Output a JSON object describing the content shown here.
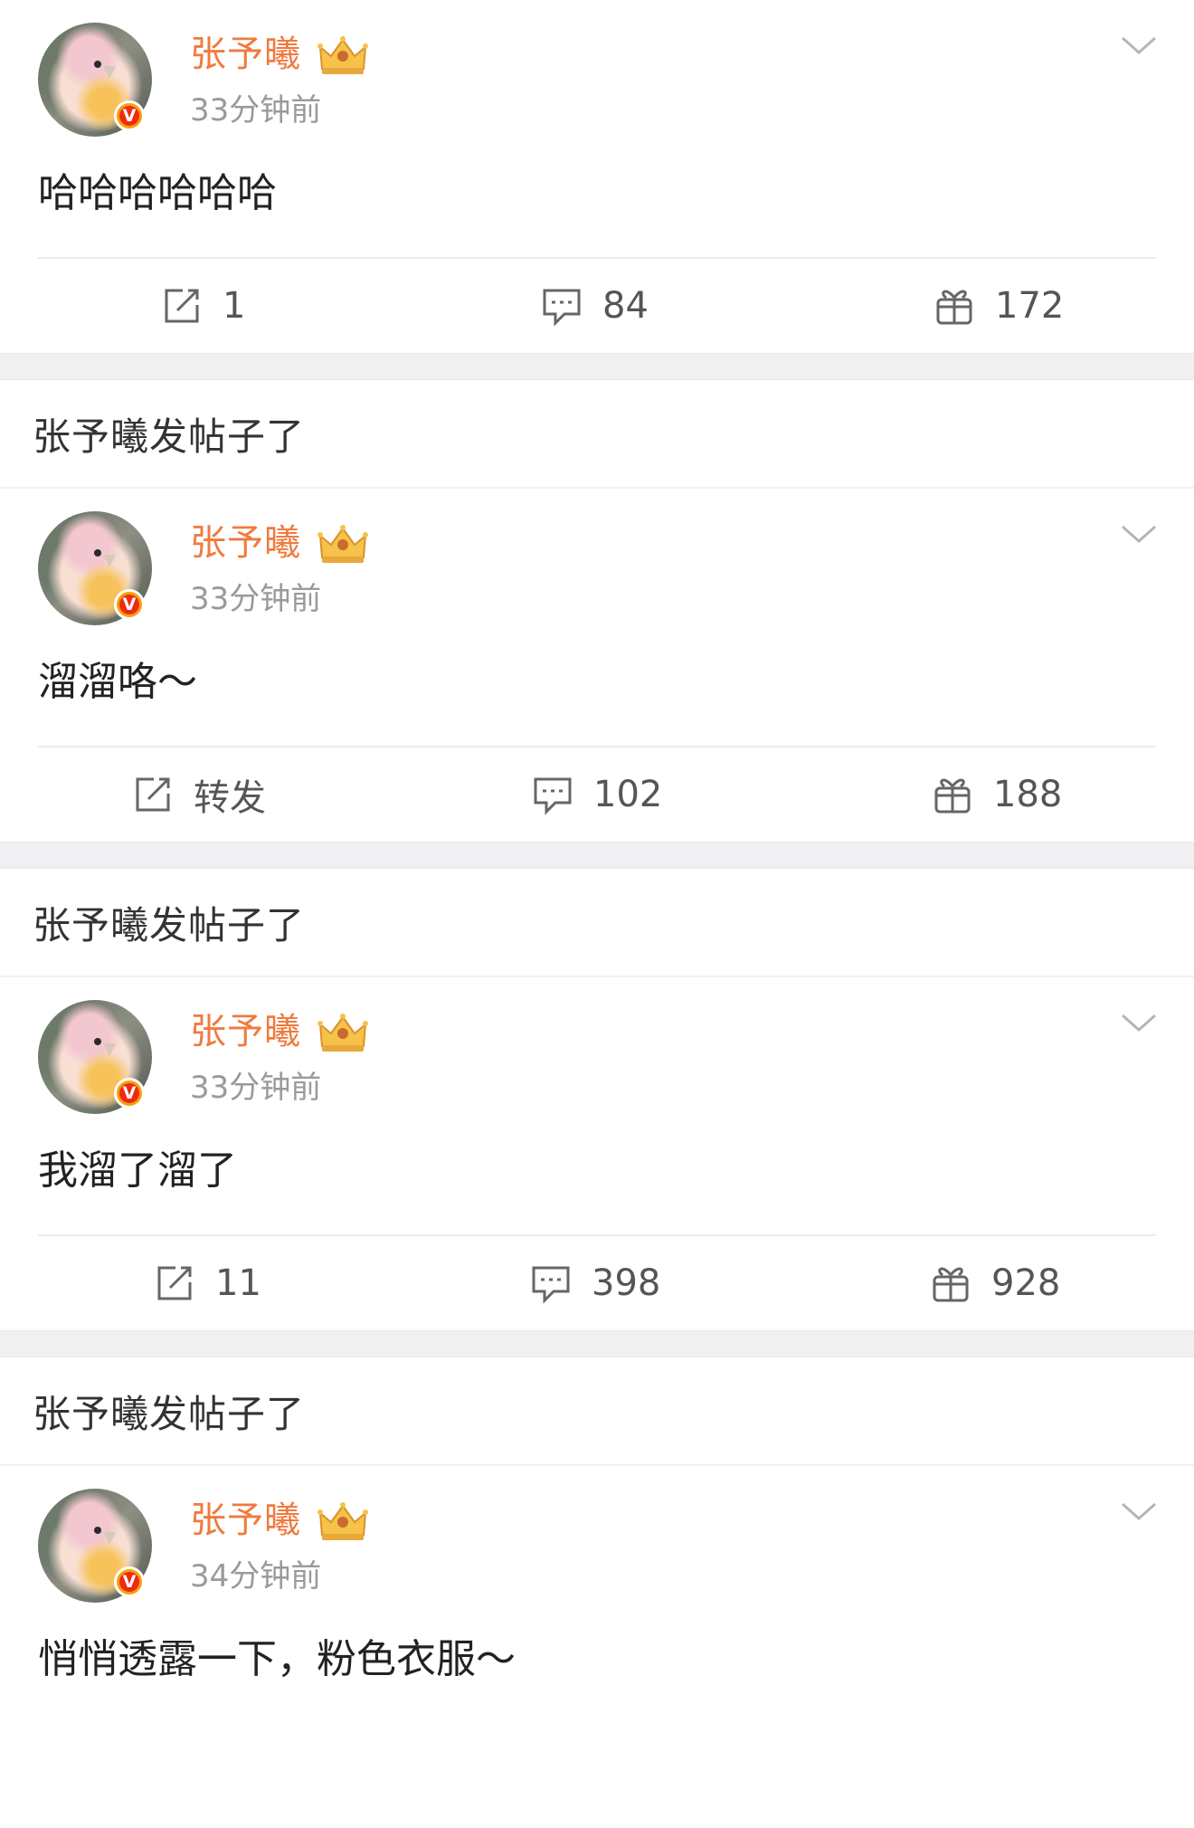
{
  "colors": {
    "username": "#f07a3e",
    "verified_badge": "#f0290f",
    "muted": "#9a9a9a"
  },
  "section_title": "张予曦发帖子了",
  "posts": [
    {
      "username": "张予曦",
      "time": "33分钟前",
      "content": "哈哈哈哈哈哈",
      "repost": "1",
      "comments": "84",
      "likes": "172"
    },
    {
      "username": "张予曦",
      "time": "33分钟前",
      "content": "溜溜咯～",
      "repost": "转发",
      "comments": "102",
      "likes": "188"
    },
    {
      "username": "张予曦",
      "time": "33分钟前",
      "content": "我溜了溜了",
      "repost": "11",
      "comments": "398",
      "likes": "928"
    },
    {
      "username": "张予曦",
      "time": "34分钟前",
      "content": "悄悄透露一下，粉色衣服～",
      "repost": "",
      "comments": "",
      "likes": ""
    }
  ],
  "icons": {
    "repost": "repost-icon",
    "comment": "comment-icon",
    "like": "like-icon",
    "crown": "crown-icon",
    "chevron": "chevron-down-icon",
    "verified": "verified-badge-icon"
  },
  "badge_letter": "V"
}
